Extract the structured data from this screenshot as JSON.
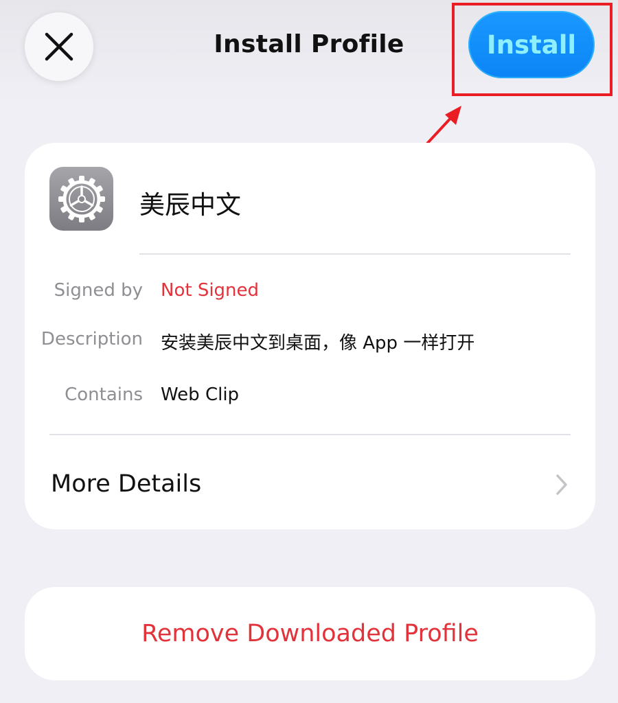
{
  "header": {
    "title": "Install Profile",
    "install_label": "Install",
    "close_icon": "close-icon"
  },
  "profile": {
    "name": "美辰中文",
    "icon": "settings-gear-icon",
    "details": [
      {
        "label": "Signed by",
        "value": "Not Signed",
        "status_color": "#e2333b"
      },
      {
        "label": "Description",
        "value": "安装美辰中文到桌面，像 App 一样打开"
      },
      {
        "label": "Contains",
        "value": "Web Clip"
      }
    ],
    "more_details_label": "More Details"
  },
  "actions": {
    "remove_label": "Remove Downloaded Profile"
  },
  "annotation": {
    "highlight_color": "#ea1c24"
  },
  "colors": {
    "accent": "#0b85f5",
    "destructive": "#e2333b",
    "background": "#f0eff5"
  }
}
